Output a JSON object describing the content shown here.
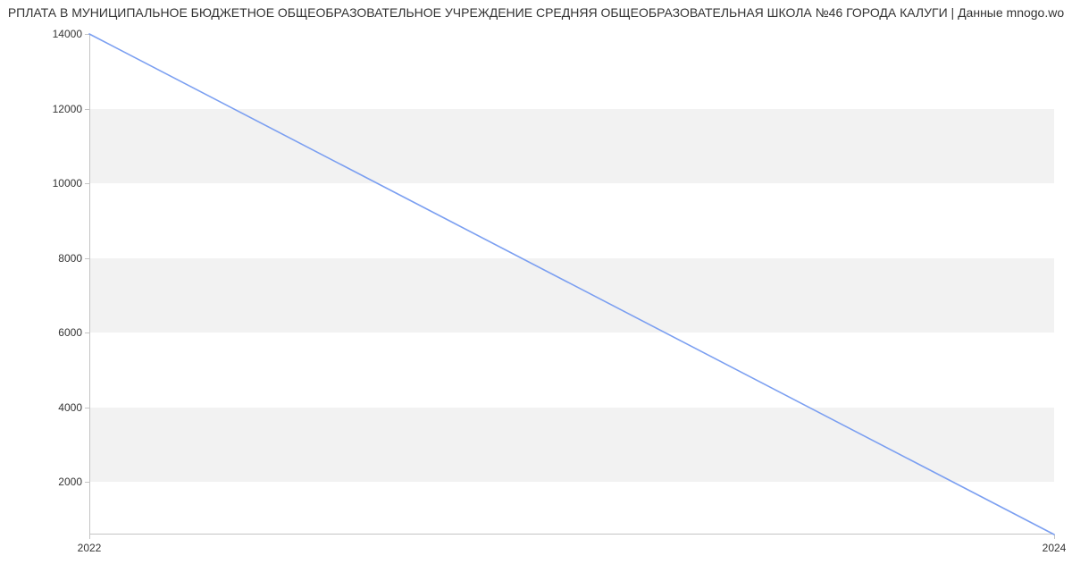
{
  "chart_data": {
    "type": "line",
    "title": "РПЛАТА В МУНИЦИПАЛЬНОЕ БЮДЖЕТНОЕ ОБЩЕОБРАЗОВАТЕЛЬНОЕ УЧРЕЖДЕНИЕ СРЕДНЯЯ ОБЩЕОБРАЗОВАТЕЛЬНАЯ ШКОЛА №46 ГОРОДА КАЛУГИ | Данные mnogo.wo",
    "x": [
      2022,
      2024
    ],
    "values": [
      14000,
      600
    ],
    "x_ticks": [
      2022,
      2024
    ],
    "y_ticks": [
      2000,
      4000,
      6000,
      8000,
      10000,
      12000,
      14000
    ],
    "xlim": [
      2022,
      2024
    ],
    "ylim": [
      600,
      14000
    ],
    "line_color": "#7b9ff1",
    "band_color": "#f2f2f2"
  }
}
